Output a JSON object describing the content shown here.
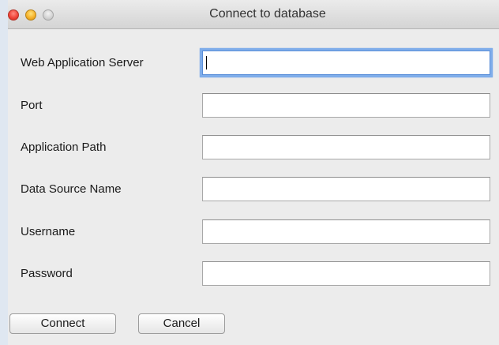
{
  "window": {
    "title": "Connect to database"
  },
  "form": {
    "fields": [
      {
        "label": "Web Application Server",
        "value": "",
        "placeholder": ""
      },
      {
        "label": "Port",
        "value": "",
        "placeholder": ""
      },
      {
        "label": "Application Path",
        "value": "",
        "placeholder": ""
      },
      {
        "label": "Data Source Name",
        "value": "",
        "placeholder": ""
      },
      {
        "label": "Username",
        "value": "",
        "placeholder": ""
      },
      {
        "label": "Password",
        "value": "",
        "placeholder": ""
      }
    ]
  },
  "buttons": {
    "connect_label": "Connect",
    "cancel_label": "Cancel"
  },
  "colors": {
    "focus_ring": "#7fadea",
    "close": "#f0453a",
    "minimize": "#f6b32c",
    "zoom": "#d2d2d2"
  }
}
